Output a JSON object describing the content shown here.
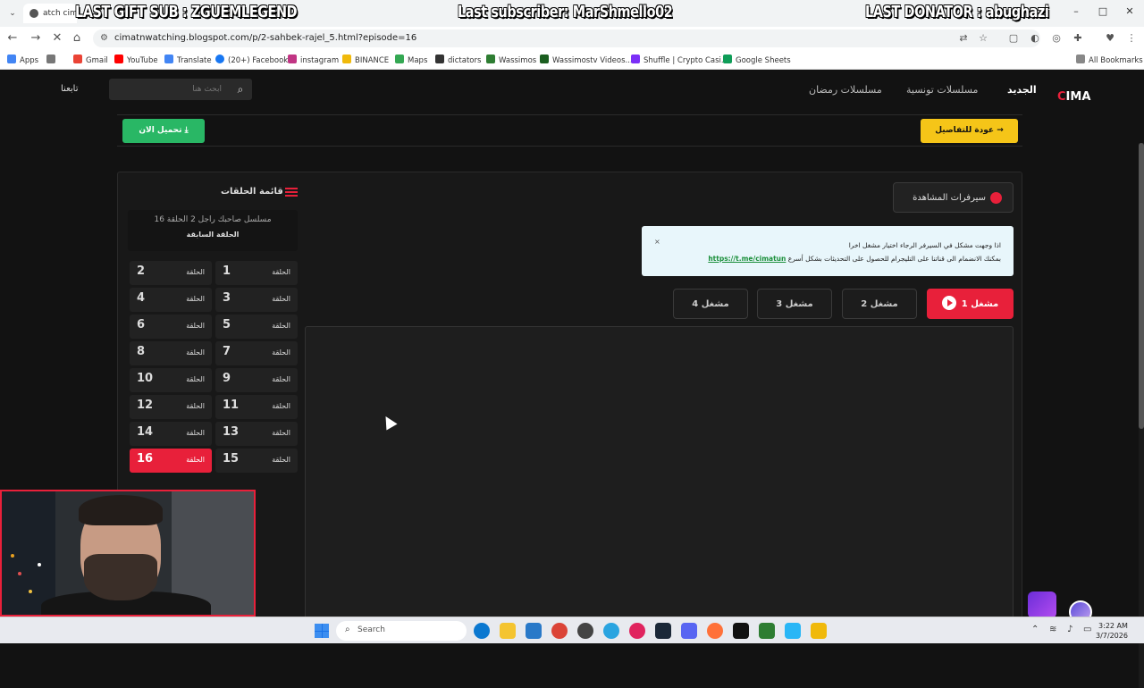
{
  "browser": {
    "tab_title": "atch cima",
    "url": "cimatnwatching.blogspot.com/p/2-sahbek-rajel_5.html?episode=16",
    "bookmarks": [
      "Apps",
      "Gmail",
      "YouTube",
      "Translate",
      "(20+) Facebook",
      "instagram",
      "BINANCE",
      "Maps",
      "dictators",
      "Wassimos",
      "Wassimostv Videos...",
      "Shuffle | Crypto Casi...",
      "Google Sheets"
    ],
    "all_bookmarks": "All Bookmarks"
  },
  "stream_overlay": {
    "gift": "LAST GIFT SUB : ZGUEMLEGEND",
    "subscriber": "Last subscriber: MarShmello02",
    "donator": "LAST DONATOR : abughazi"
  },
  "site": {
    "logo_c": "C",
    "logo_rest": "IMA",
    "nav": [
      "الجديد",
      "مسلسلات تونسية",
      "مسلسلات رمضان"
    ],
    "search_placeholder": "ابحث هنا",
    "follow": "تابعنا",
    "download_btn": "تحميل الان",
    "back_btn": "عودة للتفاصيل",
    "servers_title": "سيرفرات المشاهدة",
    "notice_line1": "اذا وجهت مشكل في السيرفر الرجاء اختيار مشغل اخرا",
    "notice_line2": "بمكنك الانضمام الى قناتنا على التليجرام للحصول على التحديثات بشكل أسرع",
    "notice_link": "https://t.me/cimatun",
    "notice_close": "×",
    "servers": [
      "مشغل 1",
      "مشغل 2",
      "مشغل 3",
      "مشغل 4"
    ],
    "episodes_title": "قائمة الحلقات",
    "series_title": "مسلسل صاحبك راجل 2 الحلقة 16",
    "prev_episode": "الحلقة السابقة",
    "episode_label": "الحلقة",
    "episodes": [
      {
        "left": "2",
        "right": "1"
      },
      {
        "left": "4",
        "right": "3"
      },
      {
        "left": "6",
        "right": "5"
      },
      {
        "left": "8",
        "right": "7"
      },
      {
        "left": "10",
        "right": "9"
      },
      {
        "left": "12",
        "right": "11"
      },
      {
        "left": "14",
        "right": "13"
      },
      {
        "left": "16",
        "right": "15"
      }
    ],
    "active_episode": "16"
  },
  "taskbar": {
    "search": "Search",
    "time": "3:22 AM",
    "date": "3/7/2026"
  },
  "colors": {
    "accent": "#e8203a",
    "green": "#29b765",
    "yellow": "#f5c518"
  }
}
